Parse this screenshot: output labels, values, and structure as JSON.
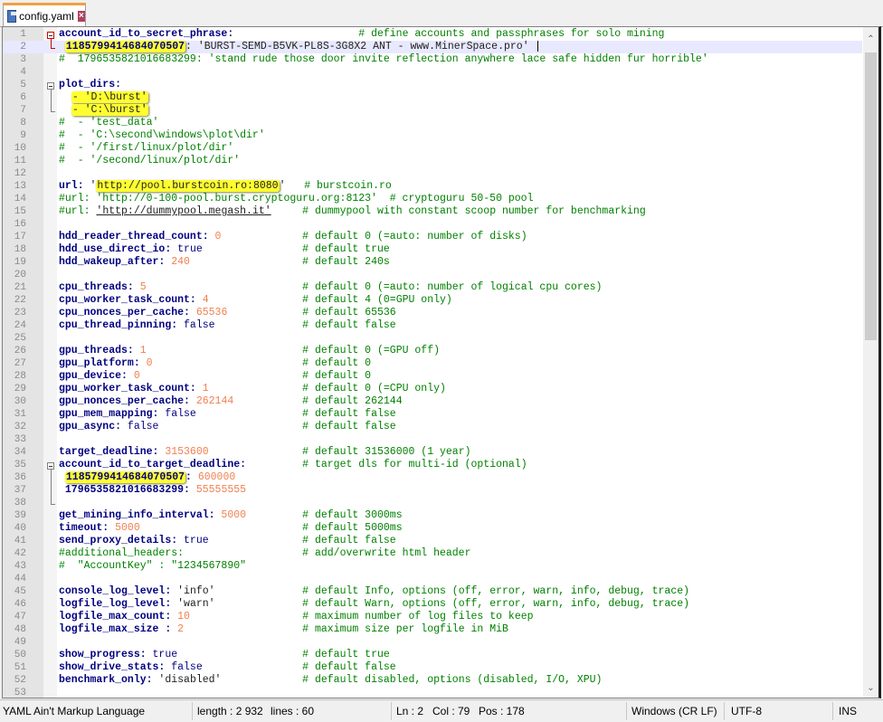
{
  "tab": {
    "label": "config.yaml",
    "icons": [
      "save-icon",
      "close-icon"
    ]
  },
  "colors": {
    "key": "#000080",
    "number": "#f08050",
    "comment": "#008000",
    "highlight": "#ffff30",
    "current_line": "#e8e8ff"
  },
  "editor": {
    "current_line": 2,
    "lines": [
      [
        [
          "k",
          "account_id_to_secret_phrase:                    "
        ],
        [
          "c",
          "# define accounts and passphrases for solo mining"
        ]
      ],
      [
        [
          "s",
          " "
        ],
        [
          "hk",
          "1185799414684070507"
        ],
        [
          "s",
          ": 'BURST-SEMD-B5VK-PL8S-3G8X2 ANT - www.MinerSpace.pro'"
        ]
      ],
      [
        [
          "c",
          "#  1796535821016683299: 'stand rude those door invite reflection anywhere lace safe hidden fur horrible'"
        ]
      ],
      [],
      [
        [
          "k",
          "plot_dirs:"
        ]
      ],
      [
        [
          "s",
          "  "
        ],
        [
          "hs",
          "- 'D:\\burst'"
        ]
      ],
      [
        [
          "s",
          "  "
        ],
        [
          "hs",
          "- 'C:\\burst'"
        ]
      ],
      [
        [
          "c",
          "#  - 'test_data'"
        ]
      ],
      [
        [
          "c",
          "#  - 'C:\\second\\windows\\plot\\dir'"
        ]
      ],
      [
        [
          "c",
          "#  - '/first/linux/plot/dir'"
        ]
      ],
      [
        [
          "c",
          "#  - '/second/linux/plot/dir'"
        ]
      ],
      [],
      [
        [
          "k",
          "url:"
        ],
        [
          "s",
          " '"
        ],
        [
          "hs",
          "http://pool.burstcoin.ro:8080"
        ],
        [
          "s",
          "'"
        ],
        [
          "t",
          "# burstcoin.ro"
        ]
      ],
      [
        [
          "c",
          "#url: 'http://0-100-pool.burst.cryptoguru.org:8123'  # cryptoguru 50-50 pool"
        ]
      ],
      [
        [
          "c",
          "#url: "
        ],
        [
          "u",
          "'http://dummypool.megash.it'"
        ],
        [
          "t",
          "# dummypool with constant scoop number for benchmarking"
        ]
      ],
      [],
      [
        [
          "k",
          "hdd_reader_thread_count:"
        ],
        [
          "n",
          " 0"
        ],
        [
          "t",
          "# default 0 (=auto: number of disks)"
        ]
      ],
      [
        [
          "k",
          "hdd_use_direct_io:"
        ],
        [
          "b",
          " true"
        ],
        [
          "t",
          "# default true"
        ]
      ],
      [
        [
          "k",
          "hdd_wakeup_after:"
        ],
        [
          "n",
          " 240"
        ],
        [
          "t",
          "# default 240s"
        ]
      ],
      [],
      [
        [
          "k",
          "cpu_threads:"
        ],
        [
          "n",
          " 5"
        ],
        [
          "t",
          "# default 0 (=auto: number of logical cpu cores)"
        ]
      ],
      [
        [
          "k",
          "cpu_worker_task_count:"
        ],
        [
          "n",
          " 4"
        ],
        [
          "t",
          "# default 4 (0=GPU only)"
        ]
      ],
      [
        [
          "k",
          "cpu_nonces_per_cache:"
        ],
        [
          "n",
          " 65536"
        ],
        [
          "t",
          "# default 65536"
        ]
      ],
      [
        [
          "k",
          "cpu_thread_pinning:"
        ],
        [
          "b",
          " false"
        ],
        [
          "t",
          "# default false"
        ]
      ],
      [],
      [
        [
          "k",
          "gpu_threads:"
        ],
        [
          "n",
          " 1"
        ],
        [
          "t",
          "# default 0 (=GPU off)"
        ]
      ],
      [
        [
          "k",
          "gpu_platform:"
        ],
        [
          "n",
          " 0"
        ],
        [
          "t",
          "# default 0"
        ]
      ],
      [
        [
          "k",
          "gpu_device:"
        ],
        [
          "n",
          " 0"
        ],
        [
          "t",
          "# default 0"
        ]
      ],
      [
        [
          "k",
          "gpu_worker_task_count:"
        ],
        [
          "n",
          " 1"
        ],
        [
          "t",
          "# default 0 (=CPU only)"
        ]
      ],
      [
        [
          "k",
          "gpu_nonces_per_cache:"
        ],
        [
          "n",
          " 262144"
        ],
        [
          "t",
          "# default 262144"
        ]
      ],
      [
        [
          "k",
          "gpu_mem_mapping:"
        ],
        [
          "b",
          " false"
        ],
        [
          "t",
          "# default false"
        ]
      ],
      [
        [
          "k",
          "gpu_async:"
        ],
        [
          "b",
          " false"
        ],
        [
          "t",
          "# default false"
        ]
      ],
      [],
      [
        [
          "k",
          "target_deadline:"
        ],
        [
          "n",
          " 3153600"
        ],
        [
          "t",
          "# default 31536000 (1 year)"
        ]
      ],
      [
        [
          "k",
          "account_id_to_target_deadline:"
        ],
        [
          "t",
          "# target dls for multi-id (optional)"
        ]
      ],
      [
        [
          "s",
          " "
        ],
        [
          "hk",
          "1185799414684070507"
        ],
        [
          "k",
          ":"
        ],
        [
          "n",
          " 600000"
        ]
      ],
      [
        [
          "k",
          " 1796535821016683299:"
        ],
        [
          "n",
          " 55555555"
        ]
      ],
      [],
      [
        [
          "k",
          "get_mining_info_interval:"
        ],
        [
          "n",
          " 5000"
        ],
        [
          "t",
          "# default 3000ms"
        ]
      ],
      [
        [
          "k",
          "timeout:"
        ],
        [
          "n",
          " 5000"
        ],
        [
          "t",
          "# default 5000ms"
        ]
      ],
      [
        [
          "k",
          "send_proxy_details:"
        ],
        [
          "b",
          " true"
        ],
        [
          "t",
          "# default false"
        ]
      ],
      [
        [
          "c",
          "#additional_headers:"
        ],
        [
          "t",
          "# add/overwrite html header"
        ]
      ],
      [
        [
          "c",
          "#  \"AccountKey\" : \"1234567890\""
        ]
      ],
      [],
      [
        [
          "k",
          "console_log_level:"
        ],
        [
          "s",
          " 'info'"
        ],
        [
          "t",
          "# default Info, options (off, error, warn, info, debug, trace)"
        ]
      ],
      [
        [
          "k",
          "logfile_log_level:"
        ],
        [
          "s",
          " 'warn'"
        ],
        [
          "t",
          "# default Warn, options (off, error, warn, info, debug, trace)"
        ]
      ],
      [
        [
          "k",
          "logfile_max_count:"
        ],
        [
          "n",
          " 10"
        ],
        [
          "t",
          "# maximum number of log files to keep"
        ]
      ],
      [
        [
          "k",
          "logfile_max_size :"
        ],
        [
          "n",
          " 2"
        ],
        [
          "t",
          "# maximum size per logfile in MiB"
        ]
      ],
      [],
      [
        [
          "k",
          "show_progress:"
        ],
        [
          "b",
          " true"
        ],
        [
          "t",
          "# default true"
        ]
      ],
      [
        [
          "k",
          "show_drive_stats:"
        ],
        [
          "b",
          " false"
        ],
        [
          "t",
          "# default false"
        ]
      ],
      [
        [
          "k",
          "benchmark_only:"
        ],
        [
          "s",
          " 'disabled'"
        ],
        [
          "t",
          "# default disabled, options (disabled, I/O, XPU)"
        ]
      ],
      []
    ]
  },
  "status": {
    "language": "YAML Ain't Markup Language",
    "length": "length : 2 932",
    "lines": "lines : 60",
    "ln": "Ln : 2",
    "col": "Col : 79",
    "pos": "Pos : 178",
    "eol": "Windows (CR LF)",
    "encoding": "UTF-8",
    "mode": "INS"
  }
}
